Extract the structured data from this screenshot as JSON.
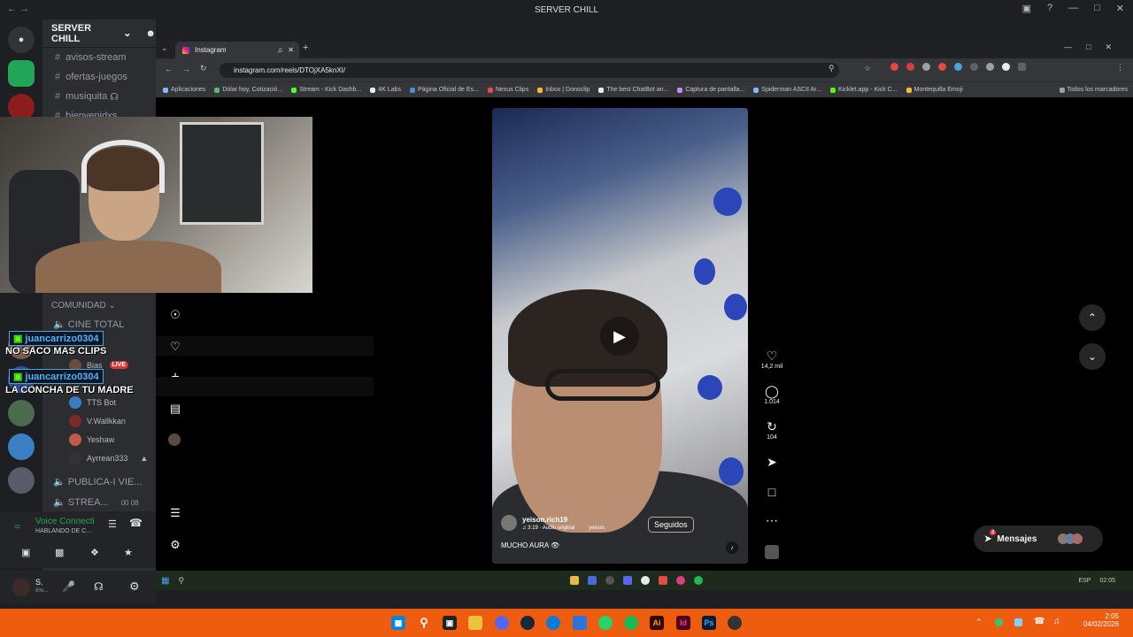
{
  "discord": {
    "window_title": "SERVER CHILL",
    "server_name": "SERVER CHILL",
    "channels": [
      "avisos-stream",
      "ofertas-juegos",
      "musiquita",
      "bienvenidxs"
    ],
    "category": "COMUNIDAD",
    "voice_channels": [
      {
        "name": "CINE TOTAL"
      },
      {
        "name": "PUBLICA-I VIE..."
      },
      {
        "name": "STREA..."
      }
    ],
    "voice_users": [
      "Bias",
      "TTS Bot",
      "V.Wallkkan",
      "Yeshaw",
      "Ayrrean333"
    ],
    "live_badge": "LIVE",
    "voice_connected": {
      "title": "Voice Connecti",
      "subtitle": "HABLANDO DE C..."
    },
    "stream_counts": "00 08",
    "user_panel": {
      "name": "S.",
      "status": "Inv..."
    }
  },
  "chat_overlay": [
    {
      "user": "juancarrizo0304",
      "message": "NO SACO MAS CLIPS"
    },
    {
      "user": "juancarrizo0304",
      "message": "LA CONCHA DE TU MADRE"
    }
  ],
  "browser": {
    "tab_title": "Instagram",
    "url": "instagram.com/reels/DTOjXA5knXI/",
    "bookmarks": [
      "Aplicaciones",
      "Dólar hoy, Cotizació...",
      "Stream - Kick Dashb...",
      "4K Labs",
      "Página Oficial de Es...",
      "Nexus Clips",
      "Inbox | Donoclip",
      "The best ChatBot an...",
      "Captura de pantalla...",
      "Spiderman ASCII Ar...",
      "Kicklet.app - Kick C...",
      "Montequilla Emoji"
    ],
    "all_bookmarks": "Todos los marcadores"
  },
  "reel": {
    "username": "yeison.rich19",
    "audio": "3:19 · Audio original",
    "audio_extra": "yeison.",
    "follow_label": "Seguidos",
    "caption": "MUCHO AURA",
    "likes": "14,2 mil",
    "comments": "1.014",
    "reposts": "104"
  },
  "messages": {
    "label": "Mensajes",
    "badge": "3"
  },
  "inner_taskbar": {
    "lang": "ESP",
    "time": "02:05"
  },
  "taskbar": {
    "time": "2:05",
    "date": "04/02/2026"
  }
}
